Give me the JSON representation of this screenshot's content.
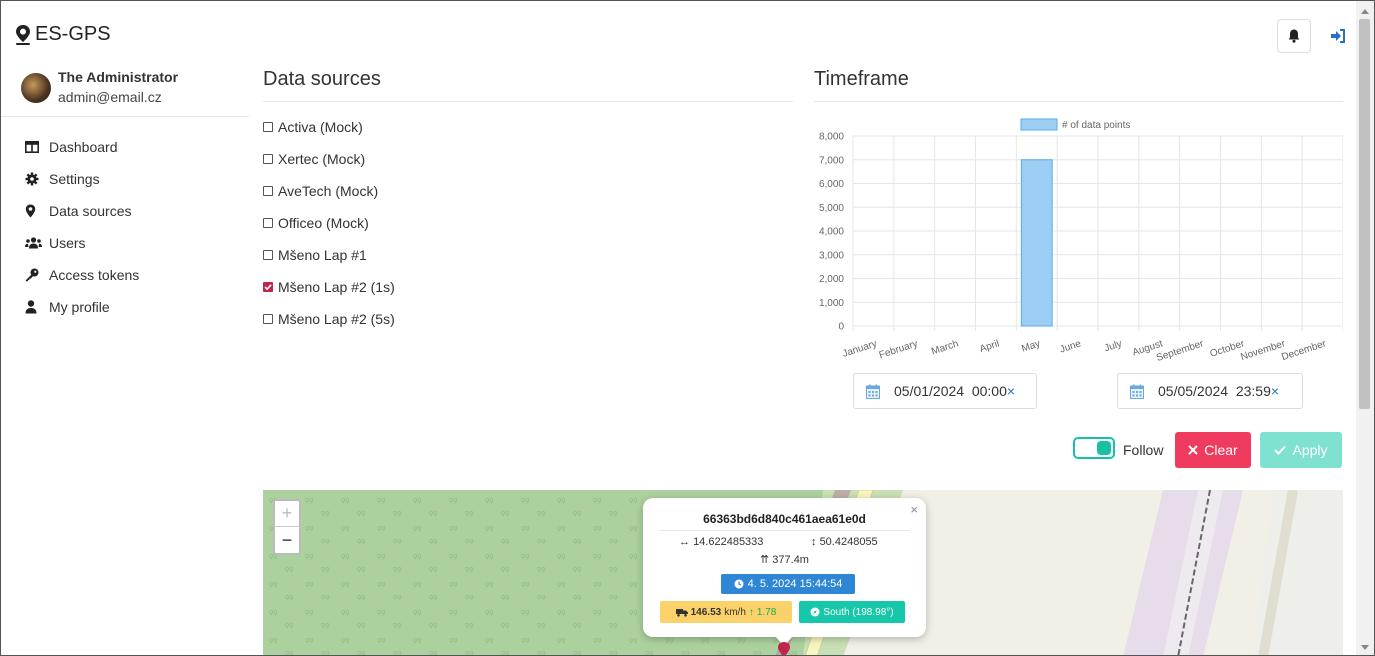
{
  "app": {
    "brand": "ES-GPS"
  },
  "user": {
    "name": "The Administrator",
    "email": "admin@email.cz"
  },
  "sidebar": {
    "items": [
      {
        "label": "Dashboard",
        "icon": "dashboard-icon"
      },
      {
        "label": "Settings",
        "icon": "gear-icon"
      },
      {
        "label": "Data sources",
        "icon": "map-pin-icon"
      },
      {
        "label": "Users",
        "icon": "users-icon"
      },
      {
        "label": "Access tokens",
        "icon": "key-icon"
      },
      {
        "label": "My profile",
        "icon": "user-icon"
      }
    ]
  },
  "data_sources": {
    "title": "Data sources",
    "items": [
      {
        "label": "Activa (Mock)",
        "checked": false
      },
      {
        "label": "Xertec (Mock)",
        "checked": false
      },
      {
        "label": "AveTech (Mock)",
        "checked": false
      },
      {
        "label": "Officeo (Mock)",
        "checked": false
      },
      {
        "label": "Mšeno Lap #1",
        "checked": false
      },
      {
        "label": "Mšeno Lap #2 (1s)",
        "checked": true
      },
      {
        "label": "Mšeno Lap #2 (5s)",
        "checked": false
      }
    ]
  },
  "timeframe": {
    "title": "Timeframe",
    "from": "05/01/2024  00:00",
    "to": "05/05/2024  23:59",
    "clear_x": "×",
    "follow_label": "Follow",
    "follow_on": true,
    "clear_label": "Clear",
    "apply_label": "Apply"
  },
  "chart_data": {
    "type": "bar",
    "categories": [
      "January",
      "February",
      "March",
      "April",
      "May",
      "June",
      "July",
      "August",
      "September",
      "October",
      "November",
      "December"
    ],
    "series": [
      {
        "name": "# of data points",
        "values": [
          0,
          0,
          0,
          0,
          7000,
          0,
          0,
          0,
          0,
          0,
          0,
          0
        ]
      }
    ],
    "ylim": [
      0,
      8000
    ],
    "yticks": [
      "0",
      "1,000",
      "2,000",
      "3,000",
      "4,000",
      "5,000",
      "6,000",
      "7,000",
      "8,000"
    ],
    "legend_position": "top",
    "grid": true,
    "colors": {
      "bar_fill": "#9ccdf3",
      "bar_stroke": "#56aee8"
    }
  },
  "map": {
    "zoom_in": "+",
    "zoom_out": "−",
    "popup": {
      "close": "×",
      "id": "66363bd6d840c461aea61e0d",
      "lon": "14.622485333",
      "lat": "50.4248055",
      "alt": "377.4m",
      "time": "4. 5. 2024 15:44:54",
      "speed_value": "146.53",
      "speed_unit": "km/h",
      "accel": "1.78",
      "direction": "South (198.98°)"
    }
  },
  "colors": {
    "accent": "#17c1a4",
    "danger": "#ef3b5d",
    "primary": "#2e86d4",
    "checkbox": "#c0254a"
  }
}
